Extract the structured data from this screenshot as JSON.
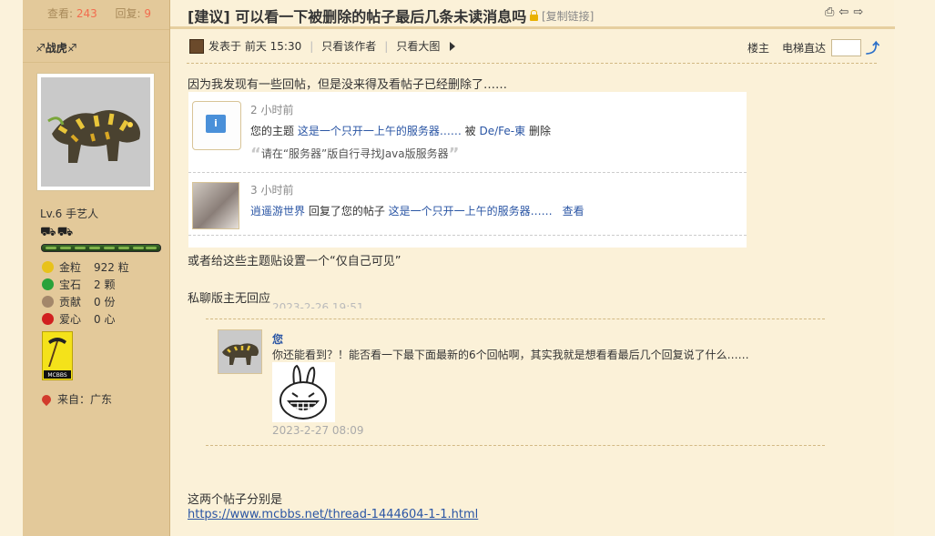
{
  "sidebar": {
    "views_label": "查看:",
    "views": "243",
    "replies_label": "回复:",
    "replies": "9",
    "author": "♐战虎♐",
    "level": "Lv.6 手艺人",
    "badges": "⛟⛟",
    "stats": [
      {
        "label": "金粒",
        "value": "922 粒",
        "icon": "gold-nugget-icon",
        "color": "#e8c21a"
      },
      {
        "label": "宝石",
        "value": "2 颗",
        "icon": "emerald-icon",
        "color": "#29a23a"
      },
      {
        "label": "贡献",
        "value": "0 份",
        "icon": "contribution-icon",
        "color": "#a3876a"
      },
      {
        "label": "爱心",
        "value": "0 心",
        "icon": "apple-heart-icon",
        "color": "#d12020"
      }
    ],
    "medal_text": "MCBBS",
    "from": "来自：广东"
  },
  "thread": {
    "title": "[建议] 可以看一下被删除的帖子最后几条未读消息吗",
    "copy_link": "[复制链接]",
    "meta": {
      "posted": "发表于 前天 15:30",
      "only_author": "只看该作者",
      "only_images": "只看大图",
      "floor": "楼主",
      "elevator": "电梯直达"
    }
  },
  "post": {
    "p1": "因为我发现有一些回帖，但是没来得及看帖子已经删除了……",
    "p2": "或者给这些主题贴设置一个“仅自己可见”",
    "p3": "私聊版主无回应",
    "p4": "这两个帖子分别是",
    "link": "https://www.mcbbs.net/thread-1444604-1-1.html"
  },
  "notices": [
    {
      "time": "2 小时前",
      "pre": "您的主题 ",
      "topic": "这是一个只开一上午的服务器……",
      "mid": " 被 ",
      "user": "De/Fe-東",
      "post": " 删除",
      "quote": "请在“服务器”版自行寻找Java版服务器"
    },
    {
      "time": "3 小时前",
      "user": "逍遥游世界",
      "mid": " 回复了您的帖子 ",
      "topic": "这是一个只开一上午的服务器……",
      "view": "查看"
    }
  ],
  "reply": {
    "date_top": "2023-2-26 19:51",
    "name": "您",
    "text": "你还能看到？！能否看一下最下面最新的6个回帖啊，其实我就是想看看最后几个回复说了什么……",
    "date": "2023-2-27 08:09"
  }
}
